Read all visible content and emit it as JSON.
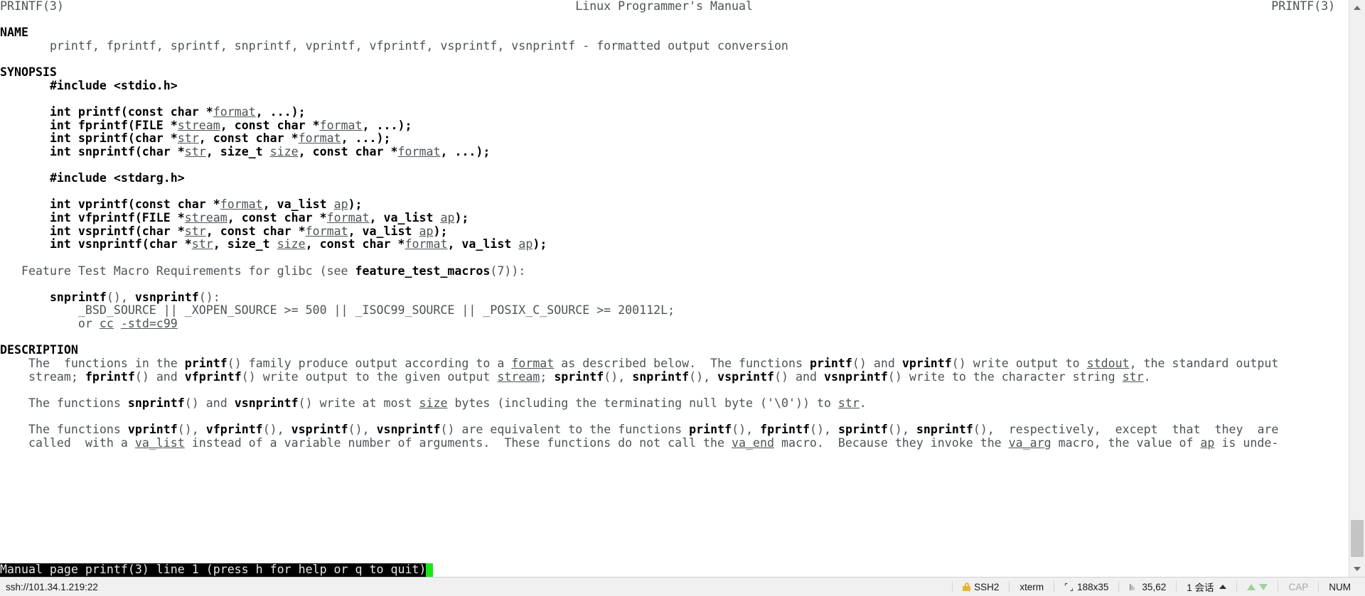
{
  "terminal": {
    "header": {
      "left": "PRINTF(3)",
      "center": "Linux Programmer's Manual",
      "right": "PRINTF(3)"
    },
    "sections": {
      "name_heading": "NAME",
      "name_body": "printf, fprintf, sprintf, snprintf, vprintf, vfprintf, vsprintf, vsnprintf - formatted output conversion",
      "synopsis_heading": "SYNOPSIS",
      "include_stdio": "#include <stdio.h>",
      "include_stdarg": "#include <stdarg.h>",
      "description_heading": "DESCRIPTION"
    },
    "prototypes": [
      {
        "ret": "int printf(const char *",
        "p1": "format",
        "tail": ", ...);"
      },
      {
        "ret": "int fprintf(FILE *",
        "p1": "stream",
        "mid": ", const char *",
        "p2": "format",
        "tail": ", ...);"
      },
      {
        "ret": "int sprintf(char *",
        "p1": "str",
        "mid": ", const char *",
        "p2": "format",
        "tail": ", ...);"
      },
      {
        "ret": "int snprintf(char *",
        "p1": "str",
        "mid": ", size_t ",
        "p2": "size",
        "mid2": ", const char *",
        "p3": "format",
        "tail": ", ...);"
      },
      {
        "ret": "int vprintf(const char *",
        "p1": "format",
        "mid": ", va_list ",
        "p2": "ap",
        "tail": ");"
      },
      {
        "ret": "int vfprintf(FILE *",
        "p1": "stream",
        "mid": ", const char *",
        "p2": "format",
        "mid2": ", va_list ",
        "p3": "ap",
        "tail": ");"
      },
      {
        "ret": "int vsprintf(char *",
        "p1": "str",
        "mid": ", const char *",
        "p2": "format",
        "mid2": ", va_list ",
        "p3": "ap",
        "tail": ");"
      },
      {
        "ret": "int vsnprintf(char *",
        "p1": "str",
        "mid": ", size_t ",
        "p2": "size",
        "mid2": ", const char *",
        "p3": "format",
        "mid3": ", va_list ",
        "p4": "ap",
        "tail": ");"
      }
    ],
    "feature_test": {
      "lead": "Feature Test Macro Requirements for glibc (see ",
      "macro": "feature_test_macros",
      "trail": "(7)):",
      "funcs_a": "snprintf",
      "funcs_a_paren": "(), ",
      "funcs_b": "vsnprintf",
      "funcs_b_paren": "():",
      "requirements": "_BSD_SOURCE || _XOPEN_SOURCE >= 500 || _ISOC99_SOURCE || _POSIX_C_SOURCE >= 200112L;",
      "or_label": "or ",
      "or_cc": "cc",
      "or_flag": "-std=c99"
    },
    "description_paragraphs": [
      {
        "lines": [
          [
            {
              "t": "The  functions in the ",
              "s": "n"
            },
            {
              "t": "printf",
              "s": "b"
            },
            {
              "t": "() family produce output according to a ",
              "s": "n"
            },
            {
              "t": "format",
              "s": "u"
            },
            {
              "t": " as described below.  The functions ",
              "s": "n"
            },
            {
              "t": "printf",
              "s": "b"
            },
            {
              "t": "() and ",
              "s": "n"
            },
            {
              "t": "vprintf",
              "s": "b"
            },
            {
              "t": "() write output to ",
              "s": "n"
            },
            {
              "t": "stdout",
              "s": "u"
            },
            {
              "t": ", the standard output",
              "s": "n"
            }
          ],
          [
            {
              "t": "stream; ",
              "s": "n"
            },
            {
              "t": "fprintf",
              "s": "b"
            },
            {
              "t": "() and ",
              "s": "n"
            },
            {
              "t": "vfprintf",
              "s": "b"
            },
            {
              "t": "() write output to the given output ",
              "s": "n"
            },
            {
              "t": "stream",
              "s": "u"
            },
            {
              "t": "; ",
              "s": "n"
            },
            {
              "t": "sprintf",
              "s": "b"
            },
            {
              "t": "(), ",
              "s": "n"
            },
            {
              "t": "snprintf",
              "s": "b"
            },
            {
              "t": "(), ",
              "s": "n"
            },
            {
              "t": "vsprintf",
              "s": "b"
            },
            {
              "t": "() and ",
              "s": "n"
            },
            {
              "t": "vsnprintf",
              "s": "b"
            },
            {
              "t": "() write to the character string ",
              "s": "n"
            },
            {
              "t": "str",
              "s": "u"
            },
            {
              "t": ".",
              "s": "n"
            }
          ]
        ]
      },
      {
        "lines": [
          [
            {
              "t": "The functions ",
              "s": "n"
            },
            {
              "t": "snprintf",
              "s": "b"
            },
            {
              "t": "() and ",
              "s": "n"
            },
            {
              "t": "vsnprintf",
              "s": "b"
            },
            {
              "t": "() write at most ",
              "s": "n"
            },
            {
              "t": "size",
              "s": "u"
            },
            {
              "t": " bytes (including the terminating null byte ('\\0')) to ",
              "s": "n"
            },
            {
              "t": "str",
              "s": "u"
            },
            {
              "t": ".",
              "s": "n"
            }
          ]
        ]
      },
      {
        "lines": [
          [
            {
              "t": "The functions ",
              "s": "n"
            },
            {
              "t": "vprintf",
              "s": "b"
            },
            {
              "t": "(), ",
              "s": "n"
            },
            {
              "t": "vfprintf",
              "s": "b"
            },
            {
              "t": "(), ",
              "s": "n"
            },
            {
              "t": "vsprintf",
              "s": "b"
            },
            {
              "t": "(), ",
              "s": "n"
            },
            {
              "t": "vsnprintf",
              "s": "b"
            },
            {
              "t": "() are equivalent to the functions ",
              "s": "n"
            },
            {
              "t": "printf",
              "s": "b"
            },
            {
              "t": "(), ",
              "s": "n"
            },
            {
              "t": "fprintf",
              "s": "b"
            },
            {
              "t": "(), ",
              "s": "n"
            },
            {
              "t": "sprintf",
              "s": "b"
            },
            {
              "t": "(), ",
              "s": "n"
            },
            {
              "t": "snprintf",
              "s": "b"
            },
            {
              "t": "(),  respectively,  except  that  they  are",
              "s": "n"
            }
          ],
          [
            {
              "t": "called  with a ",
              "s": "n"
            },
            {
              "t": "va_list",
              "s": "u"
            },
            {
              "t": " instead of a variable number of arguments.  These functions do not call the ",
              "s": "n"
            },
            {
              "t": "va_end",
              "s": "u"
            },
            {
              "t": " macro.  Because they invoke the ",
              "s": "n"
            },
            {
              "t": "va_arg",
              "s": "u"
            },
            {
              "t": " macro, the value of ",
              "s": "n"
            },
            {
              "t": "ap",
              "s": "u"
            },
            {
              "t": " is unde-",
              "s": "n"
            }
          ]
        ]
      }
    ],
    "less_status": {
      "text": "Manual page printf(3) line 1 (press h for help or q to quit)"
    }
  },
  "statusbar": {
    "connection": "ssh://101.34.1.219:22",
    "protocol": "SSH2",
    "term_type": "xterm",
    "size": "188x35",
    "cursor": "35,62",
    "sessions": "1 会话",
    "cap": "CAP",
    "num": "NUM"
  },
  "colors": {
    "terminal_bg": "#ffffff",
    "terminal_fg": "#4d5358",
    "bold_fg": "#000000",
    "less_status_bg": "#000000",
    "less_status_fg": "#e8e8e8",
    "cursor": "#19e619",
    "statusbar_bg": "#f0f0f0",
    "lock": "#e8b437",
    "arrow_green": "#9fd19f"
  }
}
